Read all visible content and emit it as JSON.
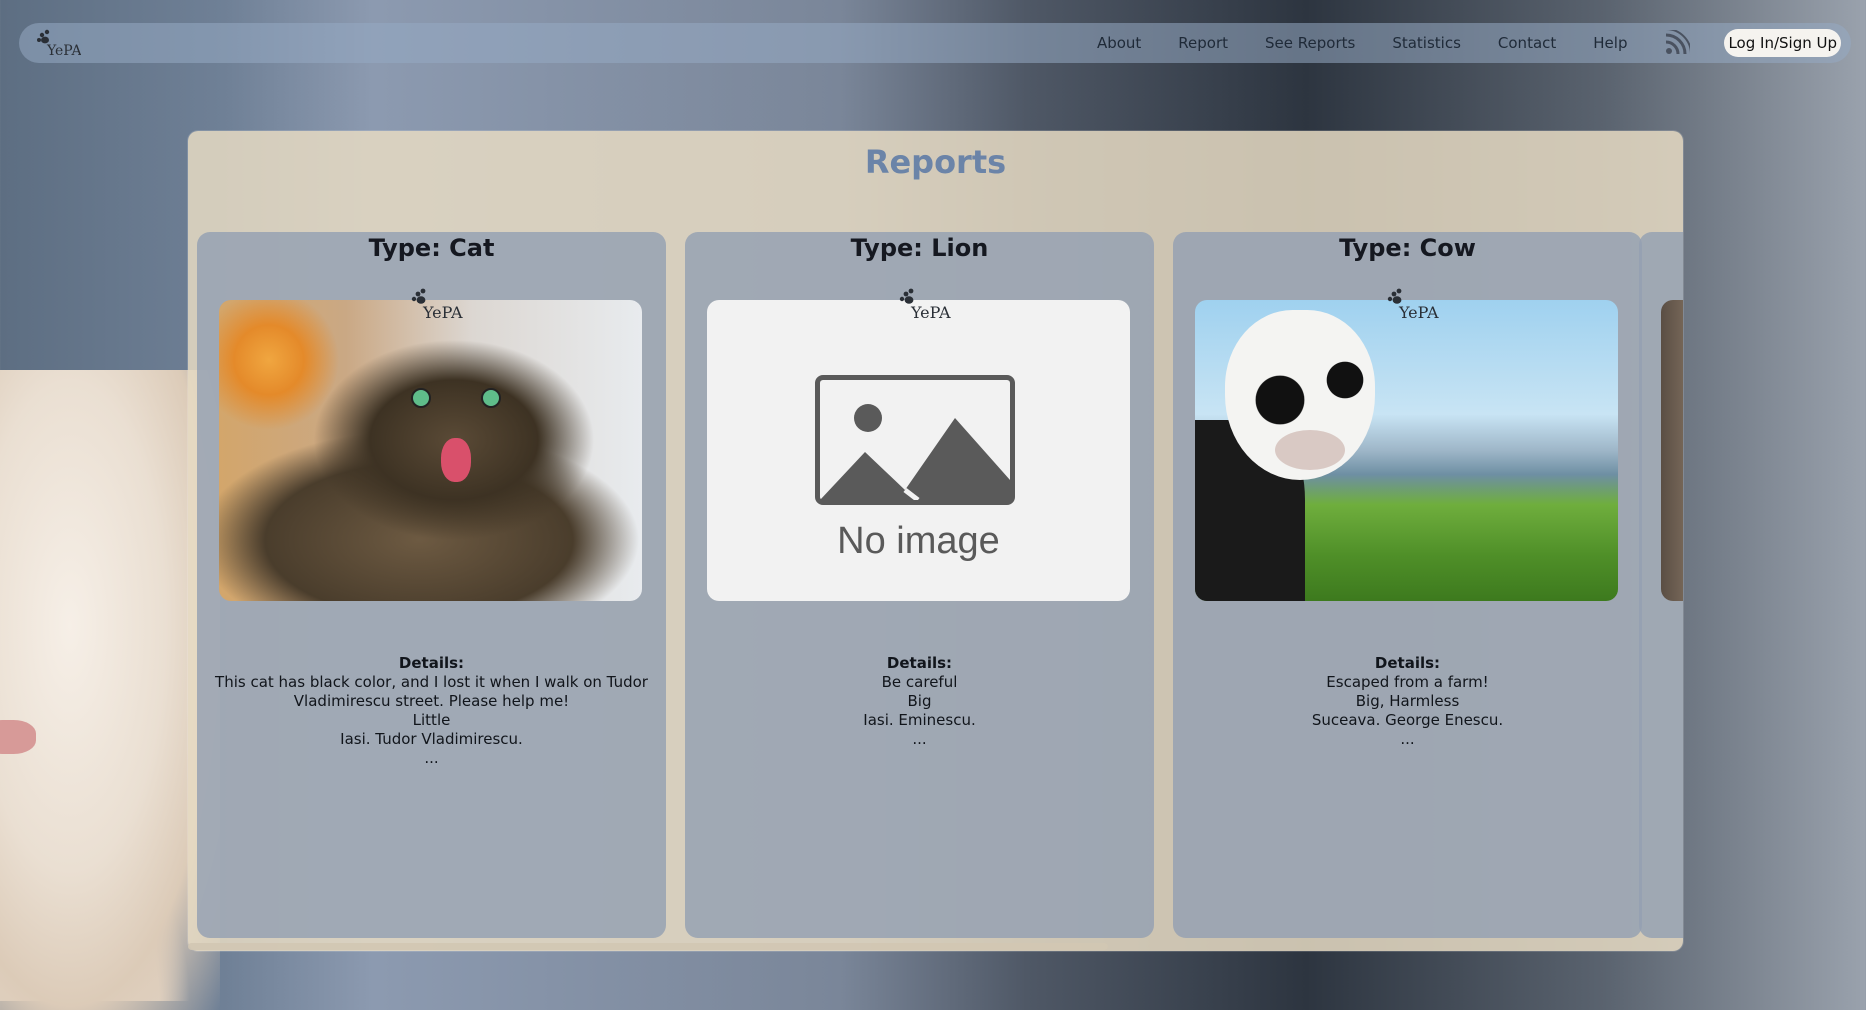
{
  "nav": {
    "logo_text": "YePA",
    "links": [
      "About",
      "Report",
      "See Reports",
      "Statistics",
      "Contact",
      "Help"
    ],
    "rss_icon": "rss-icon",
    "login_label": "Log In/Sign Up"
  },
  "page": {
    "title": "Reports"
  },
  "cards": [
    {
      "type": "Type: Cat",
      "logo_text": "YePA",
      "image": "cat-photo",
      "details_label": "Details:",
      "description": "This cat has black color, and I lost it when I walk on Tudor Vladimirescu street. Please help me!",
      "size": "Little",
      "location": "Iasi. Tudor Vladimirescu.",
      "more": "..."
    },
    {
      "type": "Type: Lion",
      "logo_text": "YePA",
      "image": "no-image-placeholder",
      "no_image_text": "No image",
      "details_label": "Details:",
      "description": "Be careful",
      "size": "Big",
      "location": "Iasi. Eminescu.",
      "more": "..."
    },
    {
      "type": "Type: Cow",
      "logo_text": "YePA",
      "image": "cow-photo",
      "details_label": "Details:",
      "description": "Escaped from a farm!",
      "size": "Big, Harmless",
      "location": "Suceava. George Enescu.",
      "more": "..."
    }
  ],
  "colors": {
    "title": "#6b84a8",
    "panel": "#e6dac3",
    "card": "#94a0b2",
    "navbar": "#96aac3"
  }
}
